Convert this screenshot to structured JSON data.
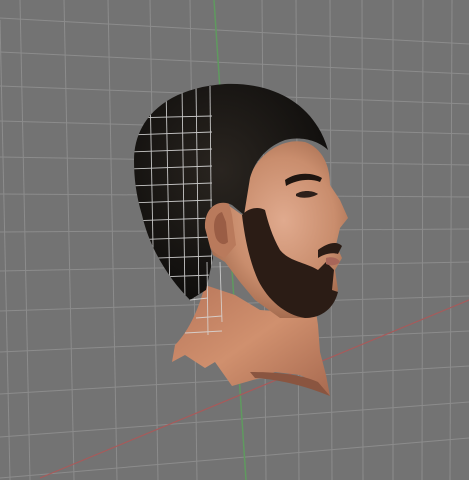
{
  "viewport": {
    "background_color": "#737373",
    "grid_color": "#8c8c8c",
    "x_axis_color": "#a85a5a",
    "z_axis_color": "#5f9a5f",
    "wire_color": "#d9d9d9"
  },
  "model": {
    "hair_color": "#141210",
    "skin_color": "#c98d6d",
    "neck_color": "#c88466",
    "beard_color": "#2b1c15",
    "lip_color": "#a86659"
  }
}
